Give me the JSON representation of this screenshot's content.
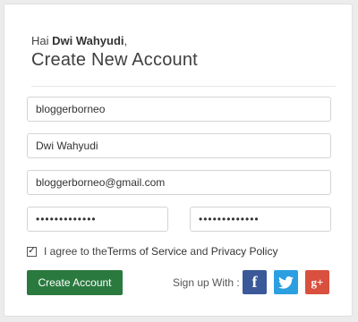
{
  "header": {
    "greeting_prefix": "Hai ",
    "user_name": "Dwi Wahyudi",
    "greeting_suffix": ",",
    "title": "Create New Account"
  },
  "form": {
    "username": "bloggerborneo",
    "full_name": "Dwi Wahyudi",
    "email": "bloggerborneo@gmail.com",
    "password": "•••••••••••••",
    "confirm_password": "•••••••••••••"
  },
  "agreement": {
    "checked": true,
    "checkbox_glyph": "✓",
    "text_prefix": "I agree to the ",
    "terms_label": "Terms of Service",
    "and_text": " and ",
    "privacy_label": "Privacy Policy"
  },
  "actions": {
    "create_label": "Create Account",
    "signup_with_label": "Sign up With :"
  },
  "social": {
    "facebook": {
      "glyph": "f",
      "icon": "facebook-icon",
      "color": "#3b5998"
    },
    "twitter": {
      "icon": "twitter-icon",
      "color": "#2b9fe0"
    },
    "googleplus": {
      "glyph": "g+",
      "icon": "google-plus-icon",
      "color": "#d9503f"
    }
  },
  "colors": {
    "primary_button": "#2a7a3f",
    "background": "#ececec"
  }
}
